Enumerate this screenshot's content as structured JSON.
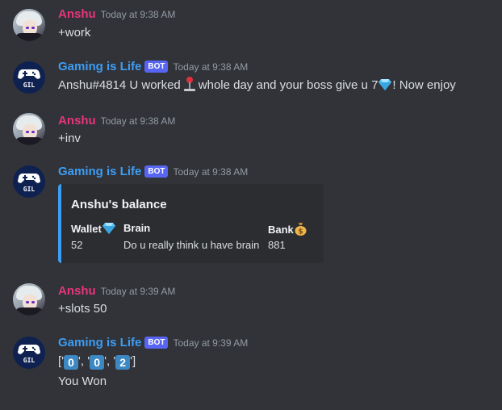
{
  "messages": [
    {
      "author": "Anshu",
      "timestamp": "Today at 9:38 AM",
      "content": "+work"
    },
    {
      "author": "Gaming is Life",
      "bot_tag": "BOT",
      "timestamp": "Today at 9:38 AM",
      "content_before": "Anshu#4814 U worked",
      "content_middle": "whole day and your boss give u 7",
      "content_after": "! Now enjoy"
    },
    {
      "author": "Anshu",
      "timestamp": "Today at 9:38 AM",
      "content": "+inv"
    },
    {
      "author": "Gaming is Life",
      "bot_tag": "BOT",
      "timestamp": "Today at 9:38 AM",
      "embed": {
        "title": "Anshu's balance",
        "fields": [
          {
            "name": "Wallet",
            "value": "52"
          },
          {
            "name": "Brain",
            "value": "Do u really think u have brain"
          },
          {
            "name": "Bank",
            "value": "881"
          }
        ]
      }
    },
    {
      "author": "Anshu",
      "timestamp": "Today at 9:39 AM",
      "content": "+slots 50"
    },
    {
      "author": "Gaming is Life",
      "bot_tag": "BOT",
      "timestamp": "Today at 9:39 AM",
      "slots": {
        "open": "['",
        "sep1": "', '",
        "sep2": "', '",
        "close": "']",
        "reels": [
          "0",
          "0",
          "2"
        ]
      },
      "result": "You Won"
    }
  ],
  "icons": {
    "user_avatar": "anime-avatar-icon",
    "bot_avatar": "gamepad-gil-icon",
    "pin": "round-pushpin-icon",
    "gem": "gem-stone-icon",
    "money_bag": "money-bag-icon"
  },
  "colors": {
    "background": "#313338",
    "user_name": "#e8347a",
    "bot_name": "#3d9df5",
    "bot_tag": "#5865f2",
    "embed_border": "#3d9df5",
    "keycap": "#3b88c3"
  }
}
